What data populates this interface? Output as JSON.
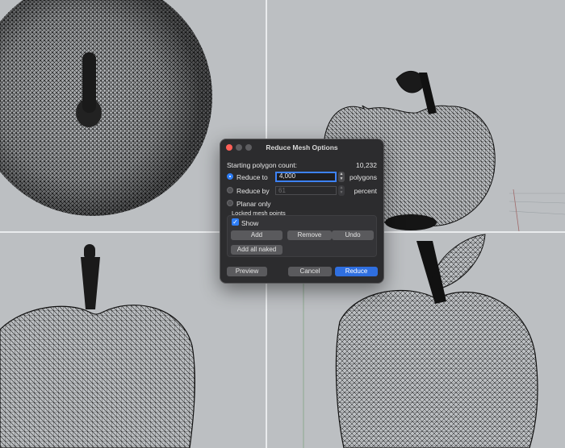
{
  "dialog": {
    "title": "Reduce Mesh Options",
    "starting_count_label": "Starting polygon count:",
    "starting_count_value": "10,232",
    "reduce_to": {
      "label": "Reduce to",
      "value": "4,000",
      "unit": "polygons",
      "selected": true
    },
    "reduce_by": {
      "label": "Reduce by",
      "value": "61",
      "unit": "percent",
      "selected": false
    },
    "planar_only": {
      "label": "Planar only"
    },
    "locked_section": {
      "label": "Locked mesh points",
      "show_label": "Show",
      "show_checked": true,
      "add_label": "Add",
      "remove_label": "Remove",
      "undo_label": "Undo",
      "add_all_naked_label": "Add all naked"
    },
    "preview_label": "Preview",
    "cancel_label": "Cancel",
    "reduce_label": "Reduce"
  },
  "icons": [
    "close-icon",
    "minimize-icon",
    "maximize-icon",
    "stepper-icon",
    "checkmark-icon"
  ],
  "colors": {
    "accent": "#2f7ef6",
    "dialog_bg": "#2c2c2e",
    "viewport_bg": "#bcbfc2",
    "wire": "#111111"
  }
}
